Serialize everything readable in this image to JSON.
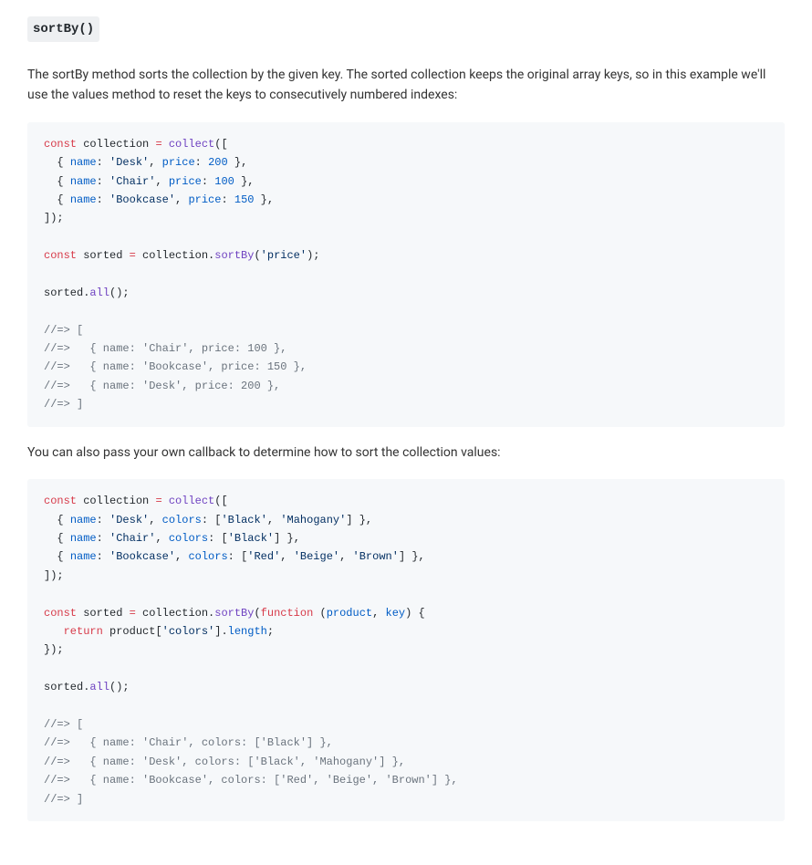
{
  "method": {
    "title": "sortBy()"
  },
  "desc1": "The sortBy method sorts the collection by the given key. The sorted collection keeps the original array keys, so in this example we'll use the values method to reset the keys to consecutively numbered indexes:",
  "desc2": "You can also pass your own callback to determine how to sort the collection values:",
  "code1": {
    "tokens": [
      [
        [
          "kw",
          "const"
        ],
        [
          "default",
          " collection "
        ],
        [
          "kw",
          "="
        ],
        [
          "default",
          " "
        ],
        [
          "fn",
          "collect"
        ],
        [
          "default",
          "(["
        ]
      ],
      [
        [
          "default",
          "  { "
        ],
        [
          "prop",
          "name"
        ],
        [
          "default",
          ": "
        ],
        [
          "str",
          "'Desk'"
        ],
        [
          "default",
          ", "
        ],
        [
          "prop",
          "price"
        ],
        [
          "default",
          ": "
        ],
        [
          "num",
          "200"
        ],
        [
          "default",
          " },"
        ]
      ],
      [
        [
          "default",
          "  { "
        ],
        [
          "prop",
          "name"
        ],
        [
          "default",
          ": "
        ],
        [
          "str",
          "'Chair'"
        ],
        [
          "default",
          ", "
        ],
        [
          "prop",
          "price"
        ],
        [
          "default",
          ": "
        ],
        [
          "num",
          "100"
        ],
        [
          "default",
          " },"
        ]
      ],
      [
        [
          "default",
          "  { "
        ],
        [
          "prop",
          "name"
        ],
        [
          "default",
          ": "
        ],
        [
          "str",
          "'Bookcase'"
        ],
        [
          "default",
          ", "
        ],
        [
          "prop",
          "price"
        ],
        [
          "default",
          ": "
        ],
        [
          "num",
          "150"
        ],
        [
          "default",
          " },"
        ]
      ],
      [
        [
          "default",
          "]);"
        ]
      ],
      [],
      [
        [
          "kw",
          "const"
        ],
        [
          "default",
          " sorted "
        ],
        [
          "kw",
          "="
        ],
        [
          "default",
          " collection."
        ],
        [
          "fn",
          "sortBy"
        ],
        [
          "default",
          "("
        ],
        [
          "str",
          "'price'"
        ],
        [
          "default",
          ");"
        ]
      ],
      [],
      [
        [
          "default",
          "sorted."
        ],
        [
          "fn",
          "all"
        ],
        [
          "default",
          "();"
        ]
      ],
      [],
      [
        [
          "cmt",
          "//=> ["
        ]
      ],
      [
        [
          "cmt",
          "//=>   { name: 'Chair', price: 100 },"
        ]
      ],
      [
        [
          "cmt",
          "//=>   { name: 'Bookcase', price: 150 },"
        ]
      ],
      [
        [
          "cmt",
          "//=>   { name: 'Desk', price: 200 },"
        ]
      ],
      [
        [
          "cmt",
          "//=> ]"
        ]
      ]
    ]
  },
  "code2": {
    "tokens": [
      [
        [
          "kw",
          "const"
        ],
        [
          "default",
          " collection "
        ],
        [
          "kw",
          "="
        ],
        [
          "default",
          " "
        ],
        [
          "fn",
          "collect"
        ],
        [
          "default",
          "(["
        ]
      ],
      [
        [
          "default",
          "  { "
        ],
        [
          "prop",
          "name"
        ],
        [
          "default",
          ": "
        ],
        [
          "str",
          "'Desk'"
        ],
        [
          "default",
          ", "
        ],
        [
          "prop",
          "colors"
        ],
        [
          "default",
          ": ["
        ],
        [
          "str",
          "'Black'"
        ],
        [
          "default",
          ", "
        ],
        [
          "str",
          "'Mahogany'"
        ],
        [
          "default",
          "] },"
        ]
      ],
      [
        [
          "default",
          "  { "
        ],
        [
          "prop",
          "name"
        ],
        [
          "default",
          ": "
        ],
        [
          "str",
          "'Chair'"
        ],
        [
          "default",
          ", "
        ],
        [
          "prop",
          "colors"
        ],
        [
          "default",
          ": ["
        ],
        [
          "str",
          "'Black'"
        ],
        [
          "default",
          "] },"
        ]
      ],
      [
        [
          "default",
          "  { "
        ],
        [
          "prop",
          "name"
        ],
        [
          "default",
          ": "
        ],
        [
          "str",
          "'Bookcase'"
        ],
        [
          "default",
          ", "
        ],
        [
          "prop",
          "colors"
        ],
        [
          "default",
          ": ["
        ],
        [
          "str",
          "'Red'"
        ],
        [
          "default",
          ", "
        ],
        [
          "str",
          "'Beige'"
        ],
        [
          "default",
          ", "
        ],
        [
          "str",
          "'Brown'"
        ],
        [
          "default",
          "] },"
        ]
      ],
      [
        [
          "default",
          "]);"
        ]
      ],
      [],
      [
        [
          "kw",
          "const"
        ],
        [
          "default",
          " sorted "
        ],
        [
          "kw",
          "="
        ],
        [
          "default",
          " collection."
        ],
        [
          "fn",
          "sortBy"
        ],
        [
          "default",
          "("
        ],
        [
          "kw",
          "function"
        ],
        [
          "default",
          " ("
        ],
        [
          "prop",
          "product"
        ],
        [
          "default",
          ", "
        ],
        [
          "prop",
          "key"
        ],
        [
          "default",
          ") {"
        ]
      ],
      [
        [
          "default",
          "   "
        ],
        [
          "kw",
          "return"
        ],
        [
          "default",
          " product["
        ],
        [
          "str",
          "'colors'"
        ],
        [
          "default",
          "]."
        ],
        [
          "prop",
          "length"
        ],
        [
          "default",
          ";"
        ]
      ],
      [
        [
          "default",
          "});"
        ]
      ],
      [],
      [
        [
          "default",
          "sorted."
        ],
        [
          "fn",
          "all"
        ],
        [
          "default",
          "();"
        ]
      ],
      [],
      [
        [
          "cmt",
          "//=> ["
        ]
      ],
      [
        [
          "cmt",
          "//=>   { name: 'Chair', colors: ['Black'] },"
        ]
      ],
      [
        [
          "cmt",
          "//=>   { name: 'Desk', colors: ['Black', 'Mahogany'] },"
        ]
      ],
      [
        [
          "cmt",
          "//=>   { name: 'Bookcase', colors: ['Red', 'Beige', 'Brown'] },"
        ]
      ],
      [
        [
          "cmt",
          "//=> ]"
        ]
      ]
    ]
  }
}
